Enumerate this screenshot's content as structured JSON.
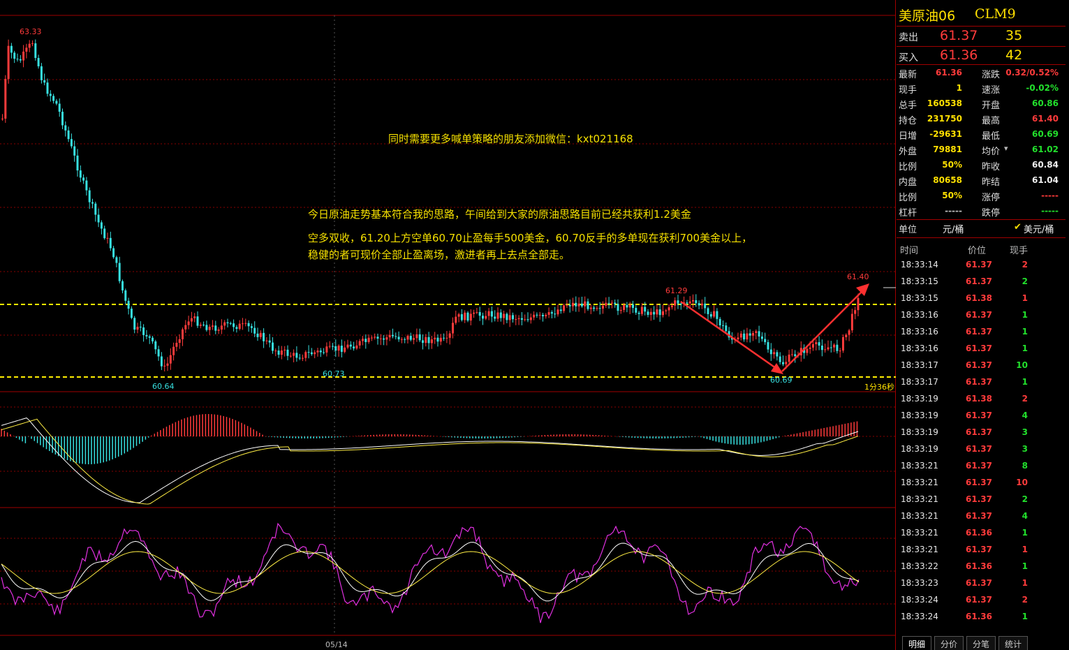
{
  "instrument": {
    "name": "美原油06",
    "code": "CLM9"
  },
  "quote": {
    "sell_label": "卖出",
    "sell_price": "61.37",
    "sell_qty": "35",
    "buy_label": "买入",
    "buy_price": "61.36",
    "buy_qty": "42"
  },
  "stats": [
    {
      "k1": "最新",
      "v1": "61.36",
      "c1": "red",
      "k2": "涨跌",
      "v2": "0.32/0.52%",
      "c2": "red"
    },
    {
      "k1": "现手",
      "v1": "1",
      "c1": "yellow",
      "k2": "速涨",
      "v2": "-0.02%",
      "c2": "green"
    },
    {
      "k1": "总手",
      "v1": "160538",
      "c1": "yellow",
      "k2": "开盘",
      "v2": "60.86",
      "c2": "green"
    },
    {
      "k1": "持仓",
      "v1": "231750",
      "c1": "yellow",
      "k2": "最高",
      "v2": "61.40",
      "c2": "red"
    },
    {
      "k1": "日增",
      "v1": "-29631",
      "c1": "yellow",
      "k2": "最低",
      "v2": "60.69",
      "c2": "green"
    },
    {
      "k1": "外盘",
      "v1": "79881",
      "c1": "yellow",
      "k2": "均价",
      "v2": "61.02",
      "c2": "green"
    },
    {
      "k1": "比例",
      "v1": "50%",
      "c1": "yellow",
      "k2": "昨收",
      "v2": "60.84",
      "c2": "white"
    },
    {
      "k1": "内盘",
      "v1": "80658",
      "c1": "yellow",
      "k2": "昨结",
      "v2": "61.04",
      "c2": "white"
    },
    {
      "k1": "比例",
      "v1": "50%",
      "c1": "yellow",
      "k2": "涨停",
      "v2": "-----",
      "c2": "red"
    },
    {
      "k1": "杠杆",
      "v1": "-----",
      "c1": "grey",
      "k2": "跌停",
      "v2": "-----",
      "c2": "green"
    }
  ],
  "unit": {
    "label": "单位",
    "opt1": "元/桶",
    "opt2": "美元/桶",
    "check": "✔"
  },
  "ticks_header": {
    "time": "时间",
    "price": "价位",
    "vol": "现手"
  },
  "ticks": [
    {
      "time": "18:33:14",
      "price": "61.37",
      "vol": "2",
      "vc": "red"
    },
    {
      "time": "18:33:15",
      "price": "61.37",
      "vol": "2",
      "vc": "green"
    },
    {
      "time": "18:33:15",
      "price": "61.38",
      "vol": "1",
      "vc": "red"
    },
    {
      "time": "18:33:16",
      "price": "61.37",
      "vol": "1",
      "vc": "green"
    },
    {
      "time": "18:33:16",
      "price": "61.37",
      "vol": "1",
      "vc": "green"
    },
    {
      "time": "18:33:16",
      "price": "61.37",
      "vol": "1",
      "vc": "green"
    },
    {
      "time": "18:33:17",
      "price": "61.37",
      "vol": "10",
      "vc": "green"
    },
    {
      "time": "18:33:17",
      "price": "61.37",
      "vol": "1",
      "vc": "green"
    },
    {
      "time": "18:33:19",
      "price": "61.38",
      "vol": "2",
      "vc": "red"
    },
    {
      "time": "18:33:19",
      "price": "61.37",
      "vol": "4",
      "vc": "green"
    },
    {
      "time": "18:33:19",
      "price": "61.37",
      "vol": "3",
      "vc": "green"
    },
    {
      "time": "18:33:19",
      "price": "61.37",
      "vol": "3",
      "vc": "green"
    },
    {
      "time": "18:33:21",
      "price": "61.37",
      "vol": "8",
      "vc": "green"
    },
    {
      "time": "18:33:21",
      "price": "61.37",
      "vol": "10",
      "vc": "red"
    },
    {
      "time": "18:33:21",
      "price": "61.37",
      "vol": "2",
      "vc": "green"
    },
    {
      "time": "18:33:21",
      "price": "61.37",
      "vol": "4",
      "vc": "green"
    },
    {
      "time": "18:33:21",
      "price": "61.36",
      "vol": "1",
      "vc": "green"
    },
    {
      "time": "18:33:21",
      "price": "61.37",
      "vol": "1",
      "vc": "red"
    },
    {
      "time": "18:33:22",
      "price": "61.36",
      "vol": "1",
      "vc": "green"
    },
    {
      "time": "18:33:23",
      "price": "61.37",
      "vol": "1",
      "vc": "red"
    },
    {
      "time": "18:33:24",
      "price": "61.37",
      "vol": "2",
      "vc": "red"
    },
    {
      "time": "18:33:24",
      "price": "61.36",
      "vol": "1",
      "vc": "green"
    }
  ],
  "tabs": [
    "明细",
    "分价",
    "分笔",
    "统计"
  ],
  "chart": {
    "labels": {
      "high": "63.33",
      "low1": "60.64",
      "low2": "60.73",
      "mark1": "61.29",
      "low3": "60.69",
      "high2": "61.40",
      "countdown": "1分36秒",
      "date": "05/14"
    }
  },
  "annotations": {
    "wechat": "同时需要更多喊单策略的朋友添加微信：kxt021168",
    "line1": "今日原油走势基本符合我的思路，午间给到大家的原油思路目前已经共获利1.2美金",
    "line2": "空多双收，61.20上方空单60.70止盈每手500美金，60.70反手的多单现在获利700美金以上，",
    "line3": "稳健的者可现价全部止盈离场，激进者再上去点全部走。"
  },
  "colors": {
    "up": "#ff3b3b",
    "down": "#37e0e0",
    "grid": "#8a0000",
    "dash": "#ffee00",
    "magenta": "#e030e0"
  }
}
